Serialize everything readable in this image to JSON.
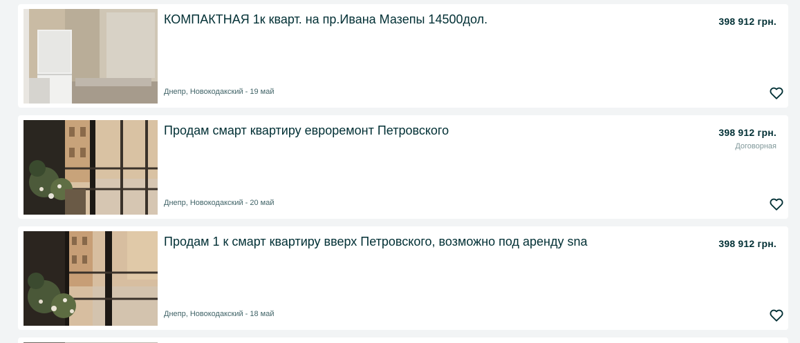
{
  "listings": [
    {
      "title": "КОМПАКТНАЯ 1к кварт. на пр.Ивана Мазепы 14500дол.",
      "price": "398 912 грн.",
      "negotiable": "",
      "location": "Днепр, Новокодакский - 19 май",
      "image": "photo-kitchen-fridge"
    },
    {
      "title": "Продам смарт квартиру евроремонт Петровского",
      "price": "398 912 грн.",
      "negotiable": "Договорная",
      "location": "Днепр, Новокодакский - 20 май",
      "image": "photo-window-plants"
    },
    {
      "title": "Продам 1 к смарт квартиру вверх Петровского, возможно под аренду sna",
      "price": "398 912 грн.",
      "negotiable": "",
      "location": "Днепр, Новокодакский - 18 май",
      "image": "photo-window-plants"
    }
  ],
  "icons": {
    "favorite": "heart-outline-icon"
  },
  "colors": {
    "background": "#f2f4f5",
    "card": "#ffffff",
    "text": "#002f34",
    "muted": "#406367"
  }
}
